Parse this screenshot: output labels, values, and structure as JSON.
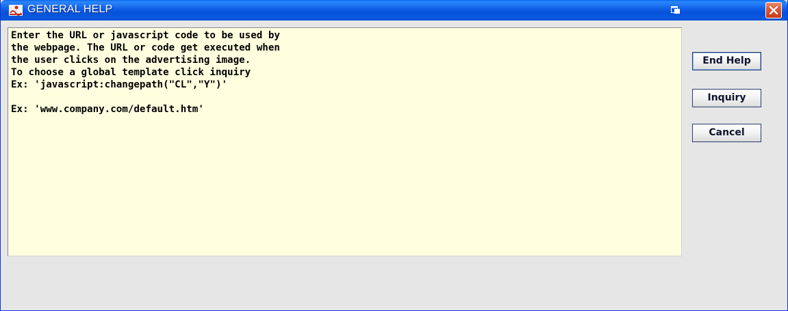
{
  "window": {
    "title": "GENERAL HELP"
  },
  "help": {
    "lines": [
      "Enter the URL or javascript code to be used by",
      "the webpage. The URL or code get executed when",
      "the user clicks on the advertising image.",
      "To choose a global template click inquiry",
      "Ex: 'javascript:changepath(\"CL\",\"Y\")'",
      "",
      "Ex: 'www.company.com/default.htm'"
    ]
  },
  "buttons": {
    "end_help": "End Help",
    "inquiry": "Inquiry",
    "cancel": "Cancel"
  },
  "icons": {
    "app": "app-logo-icon",
    "restore": "restore-window-icon",
    "close": "close-icon"
  },
  "colors": {
    "titlebar": "#0552d8",
    "text_area_bg": "#ffffe0",
    "close_button": "#dd5a38",
    "window_bg": "#e6e6e6"
  }
}
